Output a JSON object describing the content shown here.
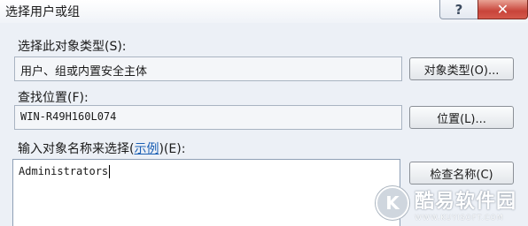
{
  "window": {
    "title": "选择用户或组",
    "help_glyph": "?",
    "close_glyph": "✕"
  },
  "object_type": {
    "label": "选择此对象类型(S):",
    "value": "用户、组或内置安全主体",
    "button": "对象类型(O)..."
  },
  "location": {
    "label": "查找位置(F):",
    "value": "WIN-R49H160L074",
    "button": "位置(L)..."
  },
  "names": {
    "label_prefix": "输入对象名称来选择(",
    "label_link": "示例",
    "label_suffix": ")(E):",
    "value": "Administrators",
    "button": "检查名称(C)"
  },
  "watermark": {
    "logo_letter": "K",
    "text": "酷易软件园",
    "url": "WWW.KUYISOFT.COM"
  }
}
